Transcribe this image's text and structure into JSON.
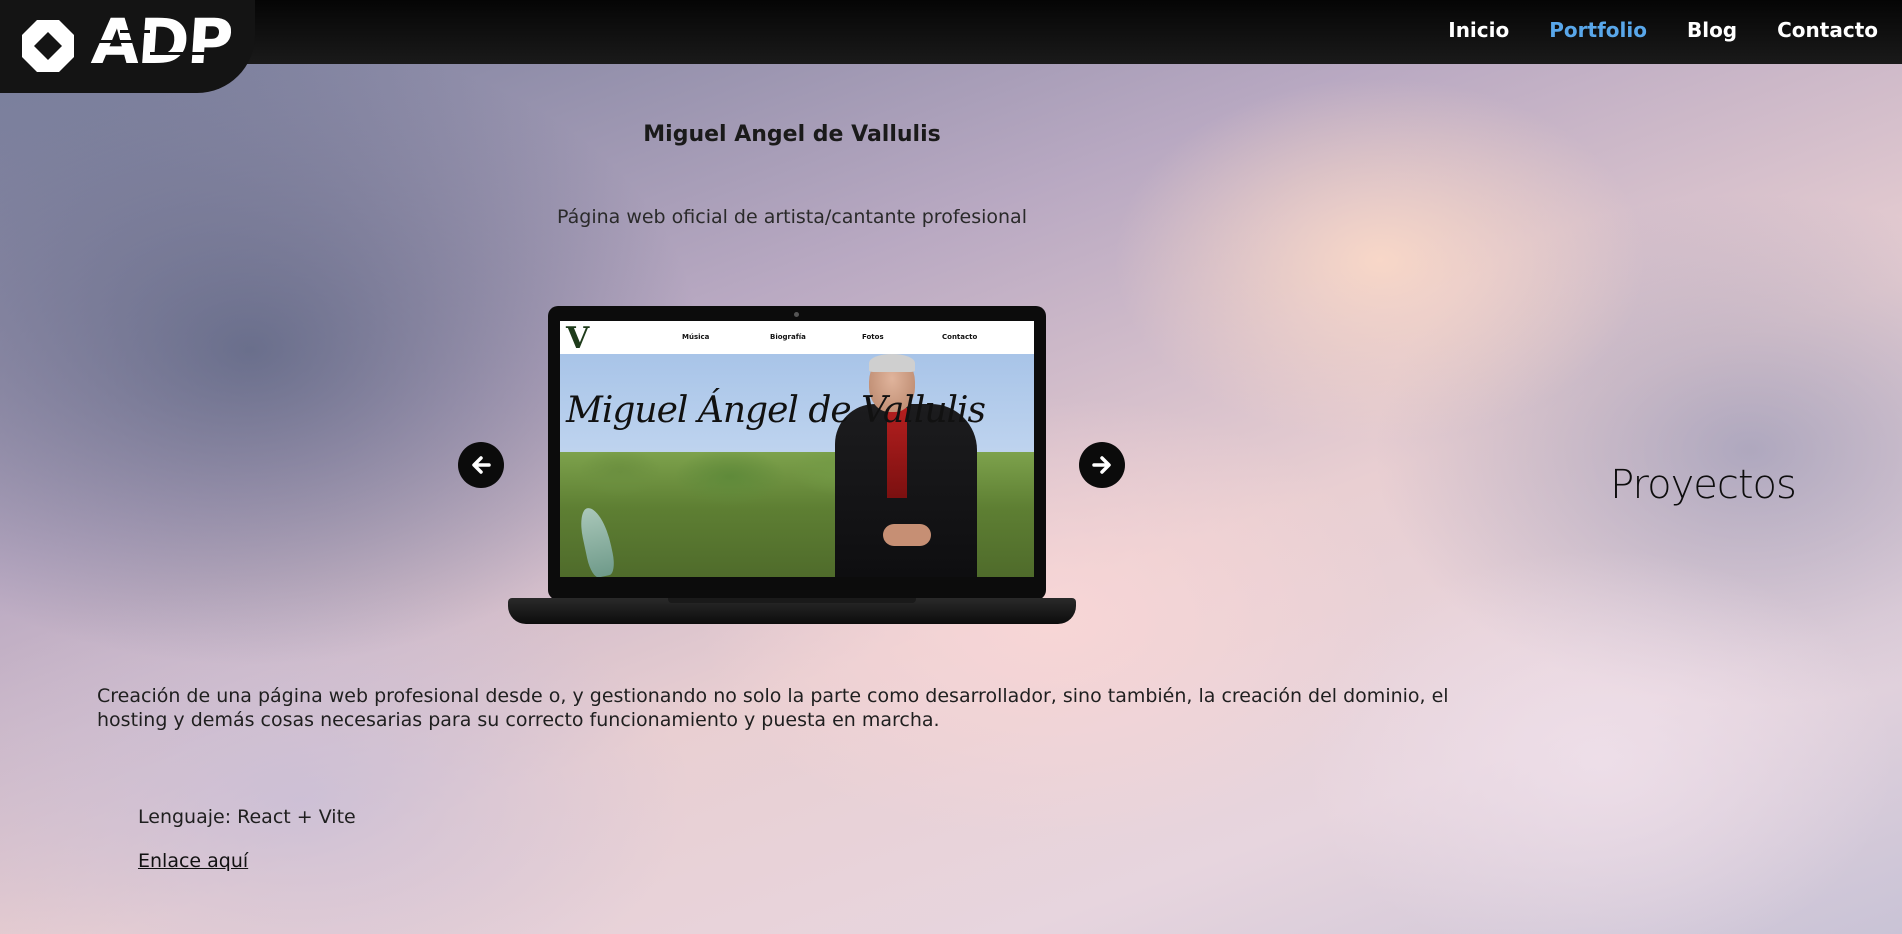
{
  "header": {
    "logo_text": "ADP",
    "nav": [
      {
        "label": "Inicio",
        "active": false
      },
      {
        "label": "Portfolio",
        "active": true
      },
      {
        "label": "Blog",
        "active": false
      },
      {
        "label": "Contacto",
        "active": false
      }
    ],
    "active_color": "#59a7ea"
  },
  "project": {
    "title": "Miguel Angel de Vallulis",
    "subtitle": "Página web oficial de artista/cantante profesional",
    "preview": {
      "site_logo": "V",
      "site_nav": [
        "Música",
        "Biografía",
        "Fotos",
        "Contacto"
      ],
      "hero_text": "Miguel Ángel de Vallulis"
    },
    "prev_icon": "arrow-left-icon",
    "next_icon": "arrow-right-icon",
    "description": "Creación de una página web profesional desde o, y gestionando no solo la parte como desarrollador, sino también, la creación del dominio, el hosting y demás cosas necesarias para su correcto funcionamiento y puesta en marcha.",
    "language": "Lenguaje: React + Vite",
    "link_label": "Enlace aquí"
  },
  "side": {
    "heading": "Proyectos"
  }
}
